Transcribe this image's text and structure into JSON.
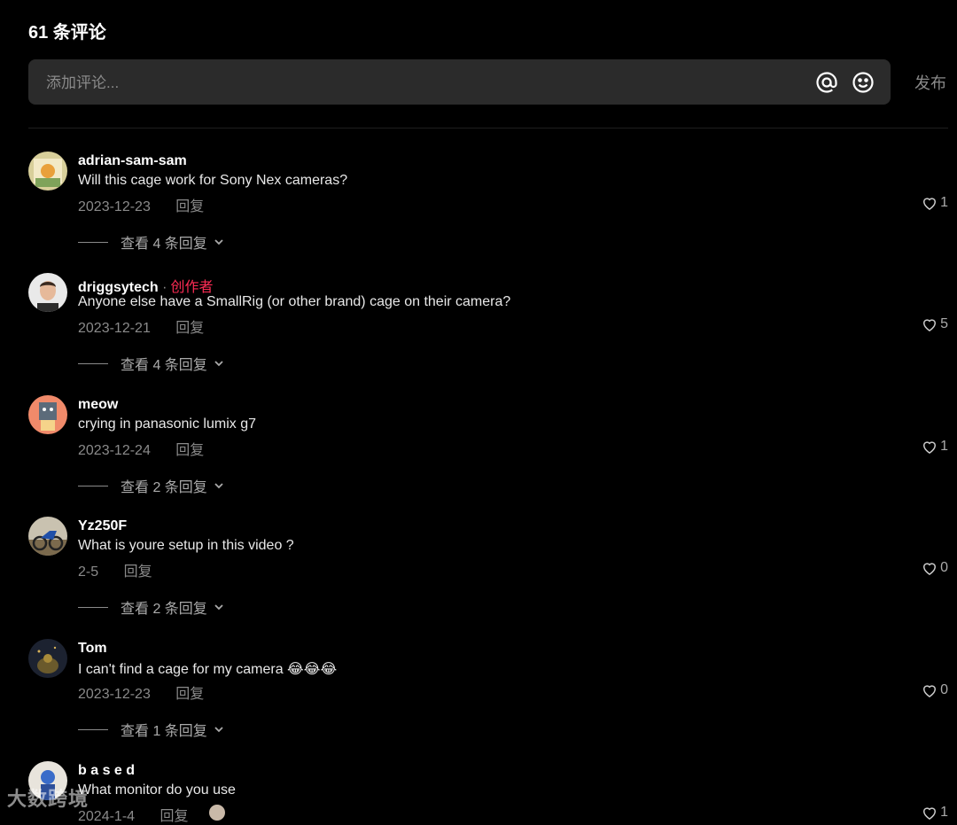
{
  "header": {
    "title": "61 条评论"
  },
  "composer": {
    "placeholder": "添加评论...",
    "mention_icon": "at-sign-icon",
    "emoji_icon": "smiley-icon",
    "post_label": "发布"
  },
  "comments": [
    {
      "username": "adrian-sam-sam",
      "is_creator": false,
      "text": "Will this cage work for Sony Nex cameras?",
      "date": "2023-12-23",
      "reply_label": "回复",
      "likes": "1",
      "view_replies": "查看 4 条回复"
    },
    {
      "username": "driggsytech",
      "is_creator": true,
      "creator_label": "创作者",
      "text": "Anyone else have a SmallRig (or other brand) cage on their camera?",
      "date": "2023-12-21",
      "reply_label": "回复",
      "likes": "5",
      "view_replies": "查看 4 条回复"
    },
    {
      "username": "meow",
      "is_creator": false,
      "text": "crying in panasonic lumix g7",
      "date": "2023-12-24",
      "reply_label": "回复",
      "likes": "1",
      "view_replies": "查看 2 条回复"
    },
    {
      "username": "Yz250F",
      "is_creator": false,
      "text": "What is youre setup in this video ?",
      "date": "2-5",
      "reply_label": "回复",
      "likes": "0",
      "view_replies": "查看 2 条回复"
    },
    {
      "username": "Tom",
      "is_creator": false,
      "text": "I can't find a cage for my camera 😂😂😂",
      "date": "2023-12-23",
      "reply_label": "回复",
      "likes": "0",
      "view_replies": "查看 1 条回复"
    },
    {
      "username": "b a s e d",
      "is_creator": false,
      "text": "What monitor do you use",
      "date": "2024-1-4",
      "reply_label": "回复",
      "likes": "1",
      "view_replies": ""
    }
  ],
  "watermark": "大数跨境"
}
